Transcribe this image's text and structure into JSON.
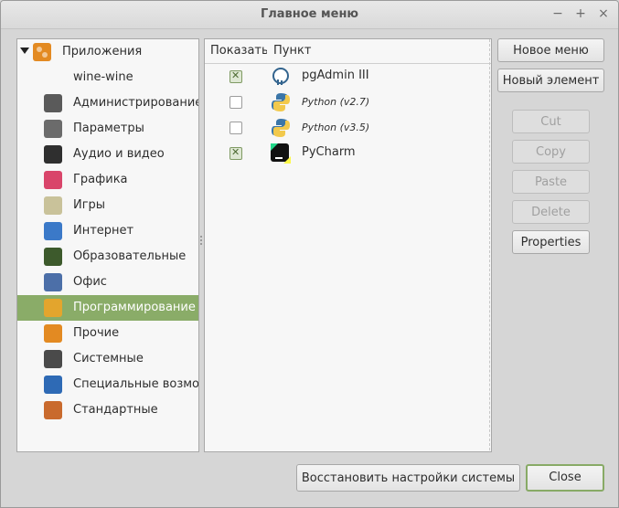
{
  "window": {
    "title": "Главное меню",
    "controls": [
      "−",
      "+",
      "×"
    ]
  },
  "tree": {
    "root_label": "Приложения",
    "items": [
      {
        "label": "wine-wine",
        "icon": "none",
        "color": ""
      },
      {
        "label": "Администрирование",
        "icon": "admin-icon",
        "color": "#5a5a5a"
      },
      {
        "label": "Параметры",
        "icon": "settings-icon",
        "color": "#6b6b6b"
      },
      {
        "label": "Аудио и видео",
        "icon": "multimedia-icon",
        "color": "#2f2f2f"
      },
      {
        "label": "Графика",
        "icon": "graphics-icon",
        "color": "#d9456a"
      },
      {
        "label": "Игры",
        "icon": "games-icon",
        "color": "#c9c29a"
      },
      {
        "label": "Интернет",
        "icon": "internet-icon",
        "color": "#3b79c8"
      },
      {
        "label": "Образовательные",
        "icon": "education-icon",
        "color": "#3d5a2c"
      },
      {
        "label": "Офис",
        "icon": "office-icon",
        "color": "#4c6fa8"
      },
      {
        "label": "Программирование",
        "icon": "programming-icon",
        "color": "#e3a52d",
        "selected": true
      },
      {
        "label": "Прочие",
        "icon": "other-icon",
        "color": "#e38a22"
      },
      {
        "label": "Системные",
        "icon": "system-icon",
        "color": "#4a4a4a"
      },
      {
        "label": "Специальные возможности",
        "icon": "accessibility-icon",
        "color": "#2e6ab5"
      },
      {
        "label": "Стандартные",
        "icon": "accessories-icon",
        "color": "#c96a2d"
      }
    ]
  },
  "table": {
    "col_show": "Показать",
    "col_item": "Пункт",
    "rows": [
      {
        "label": "pgAdmin III",
        "checked": true,
        "icon": "postgres-elephant-icon",
        "italic": false
      },
      {
        "label": "Python (v2.7)",
        "checked": false,
        "icon": "python-icon",
        "italic": true
      },
      {
        "label": "Python (v3.5)",
        "checked": false,
        "icon": "python-icon",
        "italic": true
      },
      {
        "label": "PyCharm",
        "checked": true,
        "icon": "pycharm-icon",
        "italic": false
      }
    ]
  },
  "buttons": {
    "new_menu": "Новое меню",
    "new_item": "Новый элемент",
    "cut": "Cut",
    "copy": "Copy",
    "paste": "Paste",
    "delete": "Delete",
    "properties": "Properties",
    "restore": "Восстановить настройки системы",
    "close": "Close"
  },
  "colors": {
    "selection": "#8aac68",
    "accent_border": "#88aa66"
  }
}
